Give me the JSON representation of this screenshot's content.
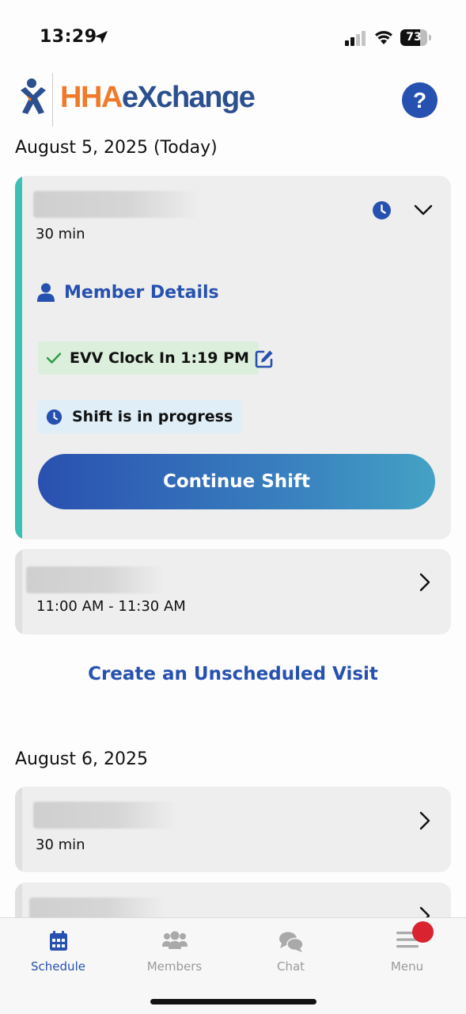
{
  "status_bar": {
    "time": "13:29",
    "battery": "73",
    "battery_level": 0.73
  },
  "header": {
    "logo_part1": "HHA",
    "logo_part2": "eXchange",
    "help_label": "?"
  },
  "sections": [
    {
      "date": "August 5, 2025 (Today)"
    },
    {
      "date": "August 6, 2025"
    }
  ],
  "active_visit": {
    "duration": "30 min",
    "member_details_label": "Member Details",
    "evv_label": "EVV Clock In 1:19 PM",
    "status_label": "Shift is in progress",
    "continue_label": "Continue Shift"
  },
  "visit2": {
    "time": "11:00 AM - 11:30 AM"
  },
  "create_visit_label": "Create an Unscheduled Visit",
  "visit3": {
    "duration": "30 min"
  },
  "nav": {
    "schedule": "Schedule",
    "members": "Members",
    "chat": "Chat",
    "menu": "Menu"
  },
  "colors": {
    "accent": "#2651b0",
    "teal": "#3cbfb4",
    "orange": "#f07a2a",
    "badge": "#d9232e"
  }
}
